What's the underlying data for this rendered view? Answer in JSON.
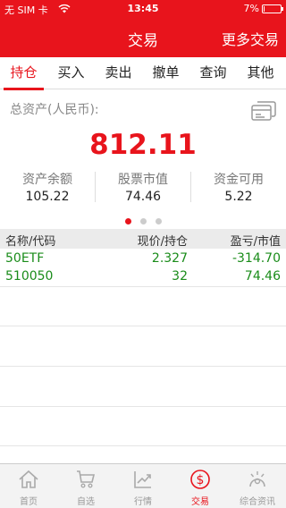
{
  "status": {
    "carrier": "无 SIM 卡",
    "time": "13:45",
    "battery": "7%",
    "battery_level": 0.07
  },
  "nav": {
    "title": "交易",
    "more": "更多交易"
  },
  "tabs": [
    {
      "label": "持仓",
      "active": true
    },
    {
      "label": "买入"
    },
    {
      "label": "卖出"
    },
    {
      "label": "撤单"
    },
    {
      "label": "查询"
    },
    {
      "label": "其他"
    }
  ],
  "assets": {
    "label": "总资产(人民币):",
    "total": "812.11",
    "stats": [
      {
        "label": "资产余额",
        "value": "105.22"
      },
      {
        "label": "股票市值",
        "value": "74.46"
      },
      {
        "label": "资金可用",
        "value": "5.22"
      }
    ]
  },
  "pager": {
    "count": 3,
    "active": 0
  },
  "table": {
    "headers": [
      "名称/代码",
      "现价/持仓",
      "盈亏/市值"
    ],
    "rows": [
      {
        "name": "50ETF",
        "code": "510050",
        "price": "2.327",
        "holding": "32",
        "pnl": "-314.70",
        "value": "74.46"
      }
    ]
  },
  "tabbar": [
    {
      "label": "首页",
      "icon": "home-icon"
    },
    {
      "label": "自选",
      "icon": "cart-icon"
    },
    {
      "label": "行情",
      "icon": "chart-icon"
    },
    {
      "label": "交易",
      "icon": "trade-icon",
      "active": true
    },
    {
      "label": "综合资讯",
      "icon": "news-icon"
    }
  ],
  "colors": {
    "brand_red": "#e8141c",
    "gain_green": "#1a8c1a"
  }
}
